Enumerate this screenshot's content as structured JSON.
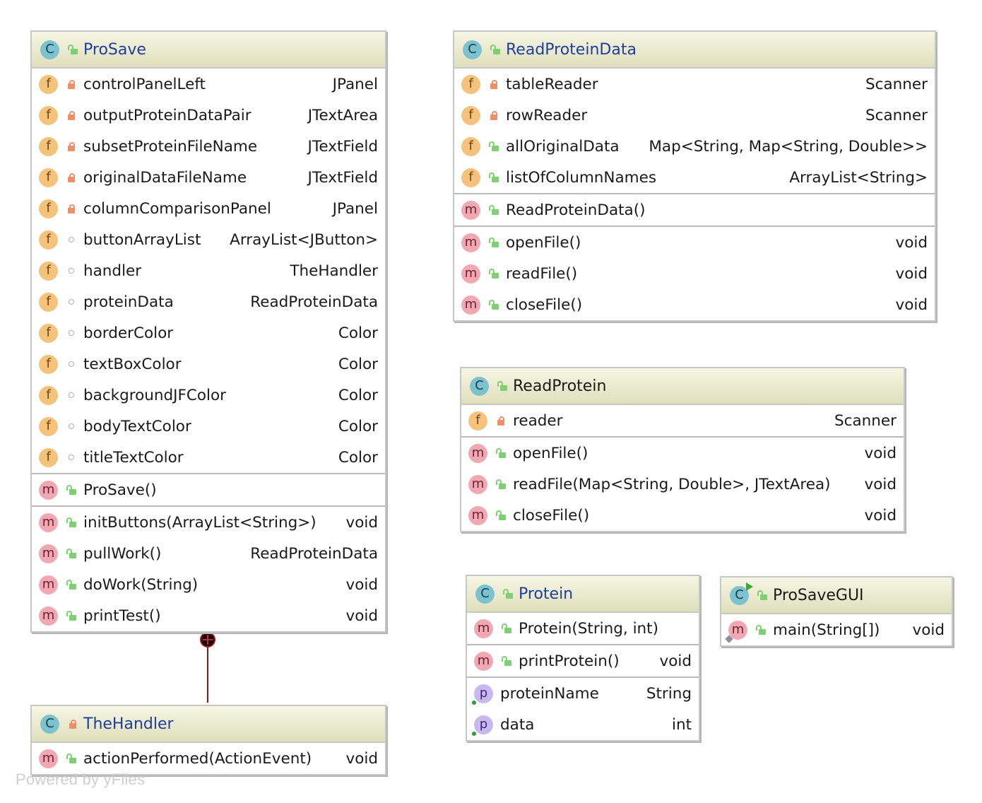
{
  "classes": {
    "prosave": {
      "title": "ProSave",
      "fields": [
        {
          "name": "controlPanelLeft",
          "type": "JPanel",
          "vis": "private"
        },
        {
          "name": "outputProteinDataPair",
          "type": "JTextArea",
          "vis": "private"
        },
        {
          "name": "subsetProteinFileName",
          "type": "JTextField",
          "vis": "private"
        },
        {
          "name": "originalDataFileName",
          "type": "JTextField",
          "vis": "private"
        },
        {
          "name": "columnComparisonPanel",
          "type": "JPanel",
          "vis": "private"
        },
        {
          "name": "buttonArrayList",
          "type": "ArrayList<JButton>",
          "vis": "package"
        },
        {
          "name": "handler",
          "type": "TheHandler",
          "vis": "package"
        },
        {
          "name": "proteinData",
          "type": "ReadProteinData",
          "vis": "package"
        },
        {
          "name": "borderColor",
          "type": "Color",
          "vis": "package"
        },
        {
          "name": "textBoxColor",
          "type": "Color",
          "vis": "package"
        },
        {
          "name": "backgroundJFColor",
          "type": "Color",
          "vis": "package"
        },
        {
          "name": "bodyTextColor",
          "type": "Color",
          "vis": "package"
        },
        {
          "name": "titleTextColor",
          "type": "Color",
          "vis": "package"
        }
      ],
      "constructors": [
        {
          "name": "ProSave()",
          "type": ""
        }
      ],
      "methods": [
        {
          "name": "initButtons(ArrayList<String>)",
          "type": "void"
        },
        {
          "name": "pullWork()",
          "type": "ReadProteinData"
        },
        {
          "name": "doWork(String)",
          "type": "void"
        },
        {
          "name": "printTest()",
          "type": "void"
        }
      ]
    },
    "thehandler": {
      "title": "TheHandler",
      "methods": [
        {
          "name": "actionPerformed(ActionEvent)",
          "type": "void"
        }
      ]
    },
    "readproteindata": {
      "title": "ReadProteinData",
      "fields": [
        {
          "name": "tableReader",
          "type": "Scanner",
          "vis": "private"
        },
        {
          "name": "rowReader",
          "type": "Scanner",
          "vis": "private"
        },
        {
          "name": "allOriginalData",
          "type": "Map<String, Map<String, Double>>",
          "vis": "public"
        },
        {
          "name": "listOfColumnNames",
          "type": "ArrayList<String>",
          "vis": "public"
        }
      ],
      "constructors": [
        {
          "name": "ReadProteinData()",
          "type": ""
        }
      ],
      "methods": [
        {
          "name": "openFile()",
          "type": "void"
        },
        {
          "name": "readFile()",
          "type": "void"
        },
        {
          "name": "closeFile()",
          "type": "void"
        }
      ]
    },
    "readprotein": {
      "title": "ReadProtein",
      "fields": [
        {
          "name": "reader",
          "type": "Scanner",
          "vis": "private"
        }
      ],
      "methods": [
        {
          "name": "openFile()",
          "type": "void"
        },
        {
          "name": "readFile(Map<String, Double>, JTextArea)",
          "type": "void"
        },
        {
          "name": "closeFile()",
          "type": "void"
        }
      ]
    },
    "protein": {
      "title": "Protein",
      "constructors": [
        {
          "name": "Protein(String, int)",
          "type": ""
        }
      ],
      "methods": [
        {
          "name": "printProtein()",
          "type": "void"
        }
      ],
      "properties": [
        {
          "name": "proteinName",
          "type": "String"
        },
        {
          "name": "data",
          "type": "int"
        }
      ]
    },
    "prosavegui": {
      "title": "ProSaveGUI",
      "methods": [
        {
          "name": "main(String[])",
          "type": "void"
        }
      ]
    }
  },
  "icons": {
    "class": "C",
    "field": "f",
    "method": "m",
    "property": "p"
  },
  "watermark": "Powered by yFiles",
  "colors": {
    "header_top": "#f6f6e4",
    "header_bottom": "#e0dfbc",
    "title_blue": "#1f3f9c",
    "connector": "#8b1a1a"
  }
}
